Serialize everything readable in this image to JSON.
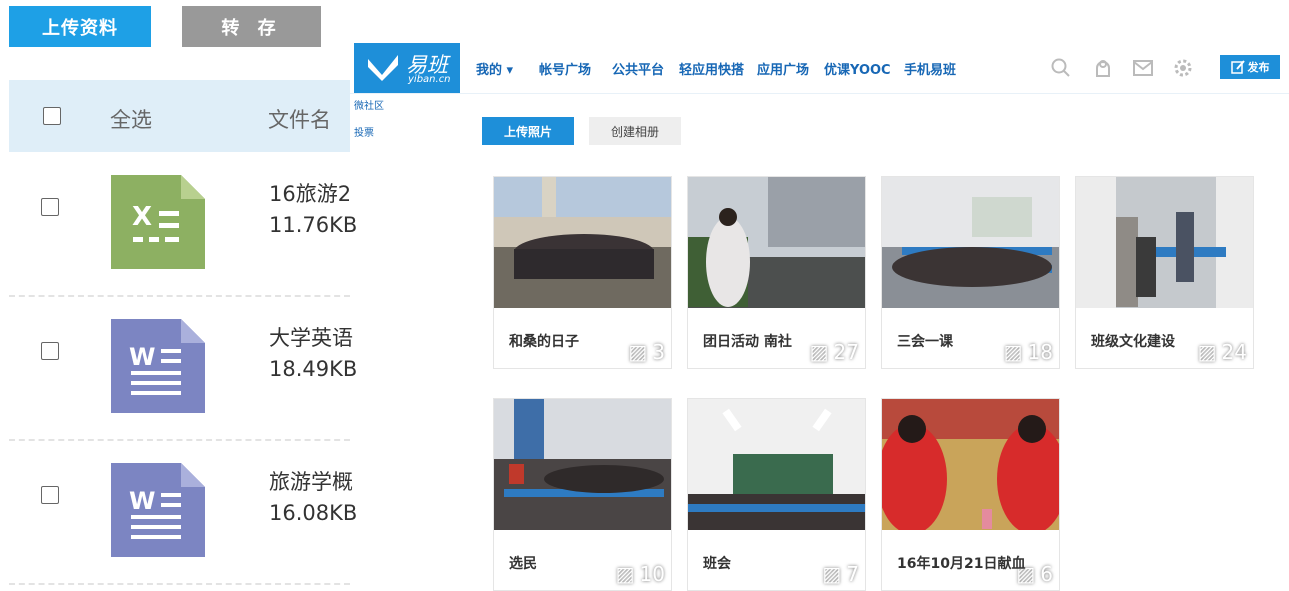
{
  "file_panel": {
    "upload_label": "上传资料",
    "transfer_label": "转 存",
    "select_all": "全选",
    "col_filename": "文件名",
    "files": [
      {
        "type": "excel",
        "icon_letter": "X",
        "name": "16旅游2",
        "size": "11.76KB"
      },
      {
        "type": "word",
        "icon_letter": "W",
        "name": "大学英语",
        "size": "18.49KB"
      },
      {
        "type": "word",
        "icon_letter": "W",
        "name": "旅游学概",
        "size": "16.08KB"
      }
    ]
  },
  "yiban": {
    "logo": {
      "text": "易班",
      "sub": "yiban.cn"
    },
    "nav": [
      "我的 ▾",
      "帐号广场",
      "公共平台",
      "轻应用快搭",
      "应用广场",
      "优课YOOC",
      "手机易班"
    ],
    "publish_label": "发布",
    "side_links": [
      "微社区",
      "投票"
    ],
    "upload_photo_label": "上传照片",
    "create_album_label": "创建相册",
    "albums": [
      {
        "title": "和桑的日子",
        "count": "3"
      },
      {
        "title": "团日活动 南社",
        "count": "27"
      },
      {
        "title": "三会一课",
        "count": "18"
      },
      {
        "title": "班级文化建设",
        "count": "24"
      },
      {
        "title": "选民",
        "count": "10"
      },
      {
        "title": "班会",
        "count": "7"
      },
      {
        "title": "16年10月21日献血",
        "count": "6"
      }
    ]
  },
  "colors": {
    "brand_blue": "#1e8fd9",
    "excel_green": "#8db062",
    "word_blue": "#7c85c2"
  }
}
